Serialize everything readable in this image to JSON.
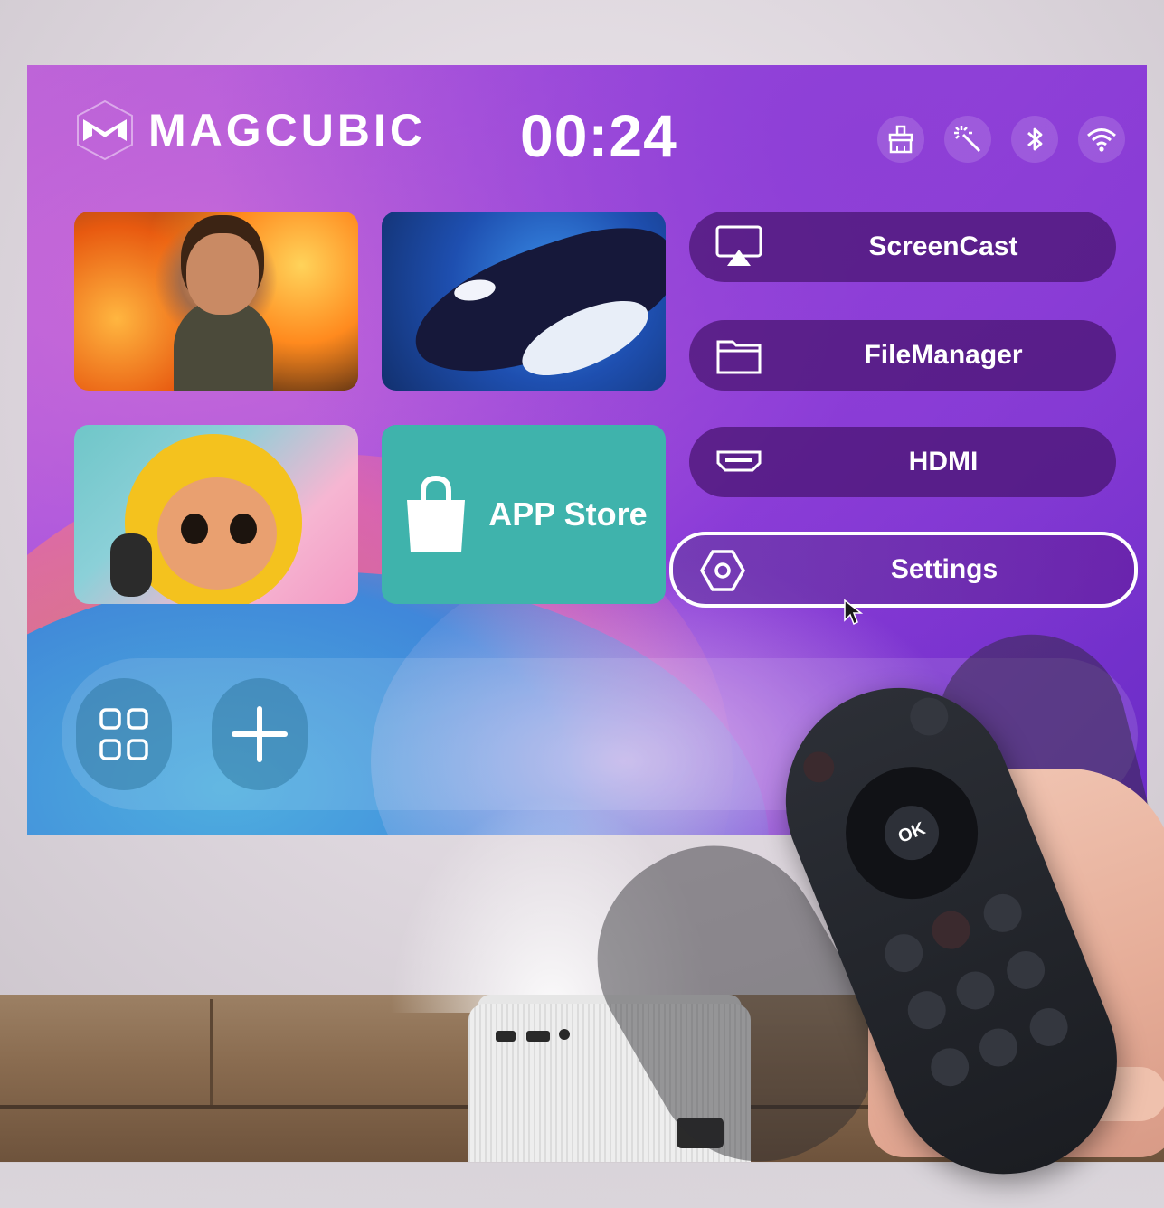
{
  "header": {
    "brand": "MAGCUBIC",
    "clock": "00:24"
  },
  "status_icons": [
    "cleaner-icon",
    "magic-wand-icon",
    "bluetooth-icon",
    "wifi-icon"
  ],
  "tiles": {
    "app_store_label": "APP Store"
  },
  "menu": [
    {
      "label": "ScreenCast",
      "icon": "screencast-icon",
      "focused": false
    },
    {
      "label": "FileManager",
      "icon": "folder-icon",
      "focused": false
    },
    {
      "label": "HDMI",
      "icon": "hdmi-port-icon",
      "focused": false
    },
    {
      "label": "Settings",
      "icon": "hexagon-settings-icon",
      "focused": true
    }
  ],
  "dock": [
    "all-apps-icon",
    "add-icon"
  ],
  "remote": {
    "ok_label": "OK"
  },
  "colors": {
    "accent_purple": "#8a3bd8",
    "menu_bg": "#46146e",
    "store_teal": "#3fb3ac"
  }
}
